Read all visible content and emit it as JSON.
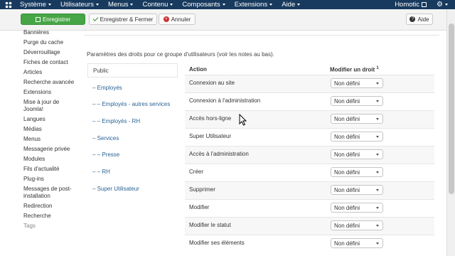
{
  "navbar": {
    "menu": [
      "Système",
      "Utilisateurs",
      "Menus",
      "Contenu",
      "Composants",
      "Extensions",
      "Aide"
    ],
    "site_name": "Homotic"
  },
  "toolbar": {
    "save_label": "Enregistrer",
    "save_close_label": "Enregistrer & Fermer",
    "cancel_label": "Annuler",
    "help_label": "Aide"
  },
  "sidebar": {
    "items": [
      "Bannières",
      "Purge du cache",
      "Déverrouillage",
      "Fiches de contact",
      "Articles",
      "Recherche avancée",
      "Extensions",
      "Mise à jour de Joomla!",
      "Langues",
      "Médias",
      "Menus",
      "Messagerie privée",
      "Modules",
      "Fils d'actualité",
      "Plug-ins",
      "Messages de post-installation",
      "Redirection",
      "Recherche",
      "Tags"
    ]
  },
  "main": {
    "intro": "Paramètres des droits pour ce groupe d'utilisateurs (voir les notes au bas).",
    "groups": [
      "Public",
      "– Employés",
      "– – Employés - autres services",
      "– – Employés - RH",
      "– Services",
      "– – Presse",
      "– – RH",
      "– Super Utilisateur"
    ],
    "table": {
      "col_action": "Action",
      "col_modify": "Modifier un droit",
      "col_modify_sup": "1",
      "rows": [
        {
          "action": "Connexion au site",
          "value": "Non défini"
        },
        {
          "action": "Connexion à l'administration",
          "value": "Non défini"
        },
        {
          "action": "Accès hors-ligne",
          "value": "Non défini"
        },
        {
          "action": "Super Utilisateur",
          "value": "Non défini"
        },
        {
          "action": "Accès à l'administration",
          "value": "Non défini"
        },
        {
          "action": "Créer",
          "value": "Non défini"
        },
        {
          "action": "Supprimer",
          "value": "Non défini"
        },
        {
          "action": "Modifier",
          "value": "Non défini"
        },
        {
          "action": "Modifier le statut",
          "value": "Non défini"
        },
        {
          "action": "Modifier ses éléments",
          "value": "Non défini"
        }
      ]
    }
  }
}
